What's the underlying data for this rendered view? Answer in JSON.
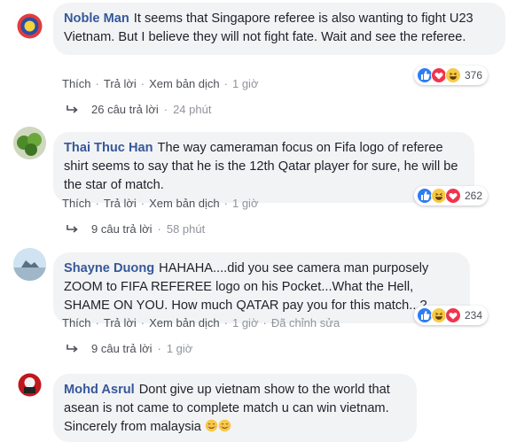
{
  "actions": {
    "like": "Thích",
    "reply": "Trả lời",
    "translate": "Xem bản dịch",
    "separator": "·"
  },
  "comments": [
    {
      "author": "Noble Man",
      "text": "It seems that Singapore referee is also wanting to fight U23 Vietnam. But I believe they will not fight fate. Wait and see the referee.",
      "time": "1 giờ",
      "reaction_count": "376",
      "reactions": [
        "like-icon",
        "love-icon",
        "haha-icon"
      ],
      "replies": "26 câu trả lời",
      "replies_time": "24 phút"
    },
    {
      "author": "Thai Thuc Han",
      "text": "The way cameraman focus on Fifa logo of referee shirt seems to say that he is the 12th Qatar player for sure, he will be the star of match.",
      "time": "1 giờ",
      "reaction_count": "262",
      "reactions": [
        "like-icon",
        "haha-icon",
        "love-icon"
      ],
      "replies": "9 câu trả lời",
      "replies_time": "58 phút"
    },
    {
      "author": "Shayne Duong",
      "text": "HAHAHA....did you see camera man purposely ZOOM to FIFA REFEREE logo on his Pocket...What the Hell, SHAME ON YOU. How much QATAR pay you for this match...?",
      "time": "1 giờ",
      "edited": "Đã chỉnh sửa",
      "reaction_count": "234",
      "reactions": [
        "like-icon",
        "haha-icon",
        "love-icon"
      ],
      "replies": "9 câu trả lời",
      "replies_time": "1 giờ"
    },
    {
      "author": "Mohd Asrul",
      "text": "Dont give up vietnam show to the world that asean is not came to complete match u can win vietnam.",
      "text2": "Sincerely from malaysia",
      "emoji": [
        "smiling-face-icon",
        "smiling-face-icon"
      ]
    }
  ],
  "colors": {
    "author": "#365899",
    "bubble": "#f2f3f5",
    "like": "#2e7bf5",
    "love": "#f0344e",
    "haha": "#f7c945"
  }
}
